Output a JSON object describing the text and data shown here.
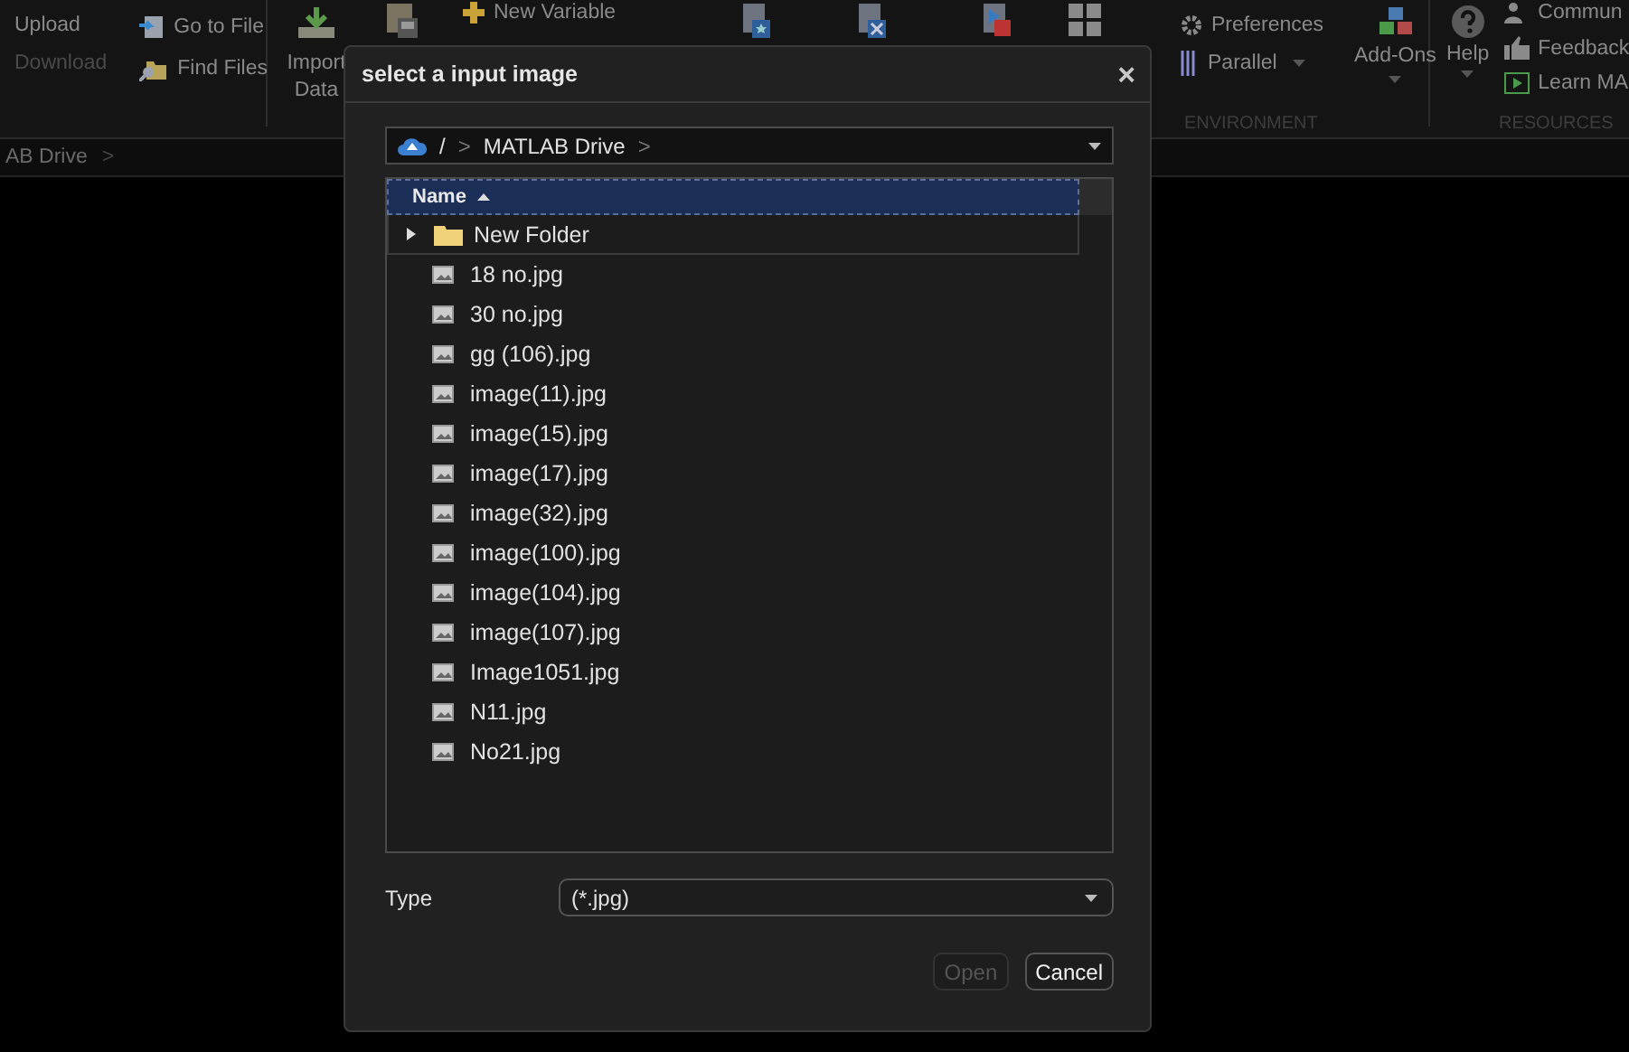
{
  "ribbon": {
    "file_actions": [
      {
        "label": "Upload",
        "disabled": false
      },
      {
        "label": "Download",
        "disabled": true
      }
    ],
    "file_tools": [
      {
        "label": "Go to File",
        "kind": "goto"
      },
      {
        "label": "Find Files",
        "kind": "find"
      }
    ],
    "import": {
      "lines": [
        "Import",
        "Data"
      ]
    },
    "variable": {
      "label": "New Variable"
    },
    "environment": {
      "preferences": "Preferences",
      "parallel": "Parallel",
      "addons": "Add-Ons",
      "section": "ENVIRONMENT"
    },
    "resources": {
      "help": "Help",
      "links": [
        {
          "label": "Commun",
          "kind": "community"
        },
        {
          "label": "Feedback",
          "kind": "feedback"
        },
        {
          "label": "Learn MA",
          "kind": "learn"
        }
      ],
      "section": "RESOURCES"
    }
  },
  "address_bar": {
    "crumb": "AB Drive",
    "separator": ">"
  },
  "dialog": {
    "title": "select a input image",
    "close": "×",
    "path": {
      "root": "/",
      "segments": [
        "MATLAB Drive"
      ],
      "separator": ">"
    },
    "list": {
      "column": "Name",
      "sort_ascending": true,
      "items": [
        {
          "name": "New Folder",
          "kind": "folder",
          "expanded": false
        },
        {
          "name": "18 no.jpg",
          "kind": "image"
        },
        {
          "name": "30 no.jpg",
          "kind": "image"
        },
        {
          "name": "gg (106).jpg",
          "kind": "image"
        },
        {
          "name": "image(11).jpg",
          "kind": "image"
        },
        {
          "name": "image(15).jpg",
          "kind": "image"
        },
        {
          "name": "image(17).jpg",
          "kind": "image"
        },
        {
          "name": "image(32).jpg",
          "kind": "image"
        },
        {
          "name": "image(100).jpg",
          "kind": "image"
        },
        {
          "name": "image(104).jpg",
          "kind": "image"
        },
        {
          "name": "image(107).jpg",
          "kind": "image"
        },
        {
          "name": "Image1051.jpg",
          "kind": "image"
        },
        {
          "name": "N11.jpg",
          "kind": "image"
        },
        {
          "name": "No21.jpg",
          "kind": "image"
        }
      ]
    },
    "type_label": "Type",
    "type_value": "(*.jpg)",
    "buttons": [
      {
        "label": "Open",
        "disabled": true
      },
      {
        "label": "Cancel",
        "disabled": false
      }
    ]
  }
}
